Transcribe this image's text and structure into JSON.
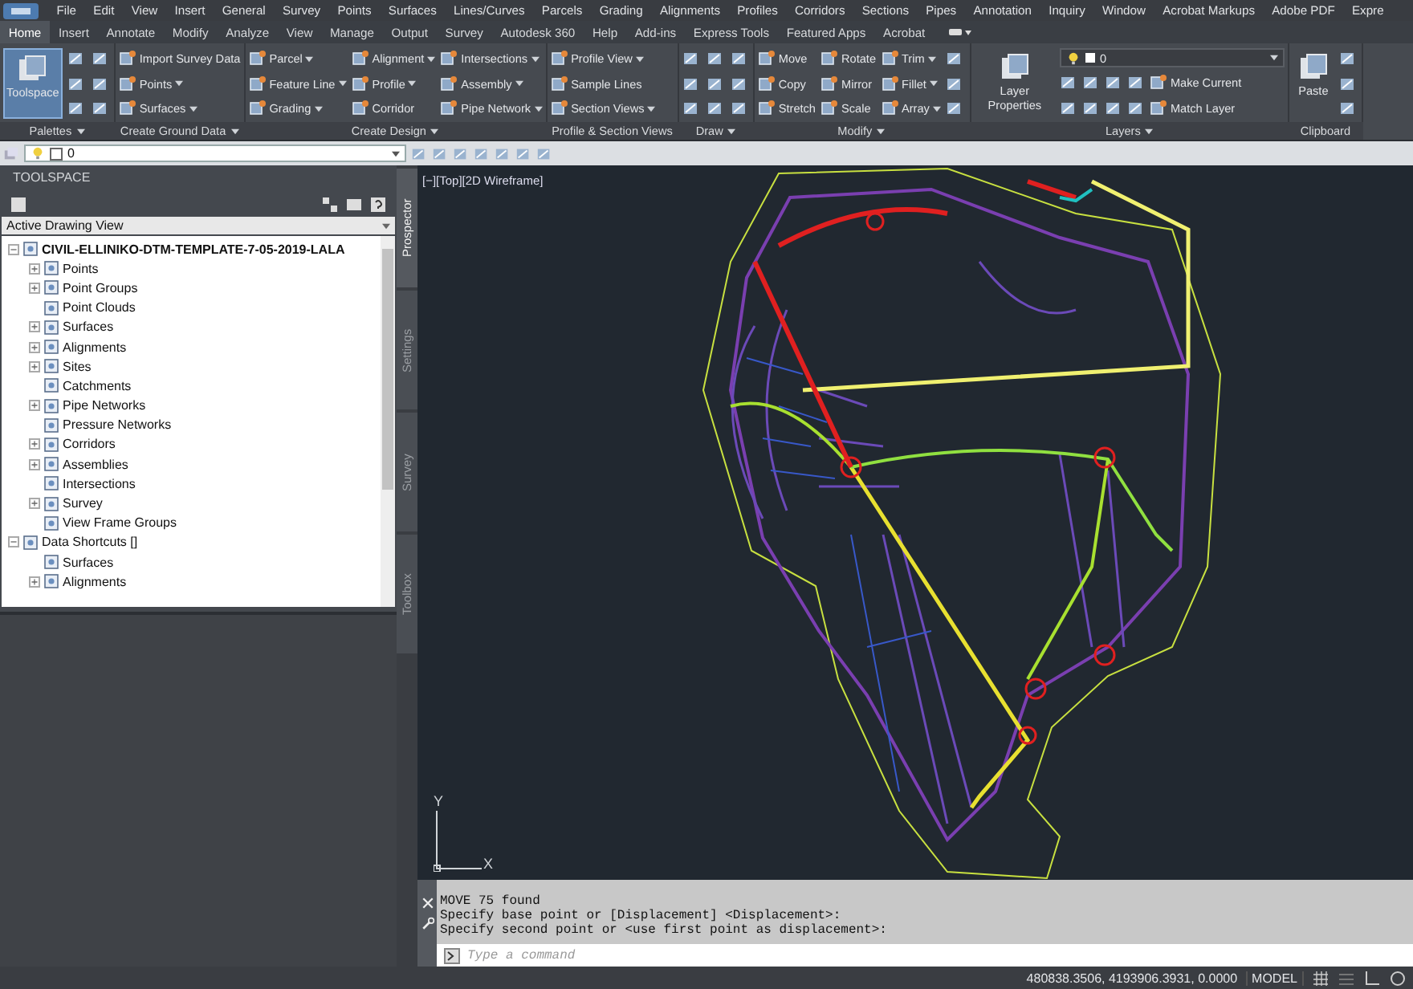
{
  "menu_bar": {
    "items": [
      "File",
      "Edit",
      "View",
      "Insert",
      "General",
      "Survey",
      "Points",
      "Surfaces",
      "Lines/Curves",
      "Parcels",
      "Grading",
      "Alignments",
      "Profiles",
      "Corridors",
      "Sections",
      "Pipes",
      "Annotation",
      "Inquiry",
      "Window",
      "Acrobat Markups",
      "Adobe PDF",
      "Expre"
    ]
  },
  "ribbon_tabs": [
    {
      "label": "Home",
      "selected": true
    },
    {
      "label": "Insert",
      "selected": false
    },
    {
      "label": "Annotate",
      "selected": false
    },
    {
      "label": "Modify",
      "selected": false
    },
    {
      "label": "Analyze",
      "selected": false
    },
    {
      "label": "View",
      "selected": false
    },
    {
      "label": "Manage",
      "selected": false
    },
    {
      "label": "Output",
      "selected": false
    },
    {
      "label": "Survey",
      "selected": false
    },
    {
      "label": "Autodesk 360",
      "selected": false
    },
    {
      "label": "Help",
      "selected": false
    },
    {
      "label": "Add-ins",
      "selected": false
    },
    {
      "label": "Express Tools",
      "selected": false
    },
    {
      "label": "Featured Apps",
      "selected": false
    },
    {
      "label": "Acrobat",
      "selected": false
    }
  ],
  "ribbon_panels": [
    {
      "title": "Palettes",
      "dropdown": true,
      "columns": [
        [
          {
            "kind": "large",
            "label": "Toolspace",
            "selected": true
          }
        ],
        [
          {
            "kind": "icon"
          },
          {
            "kind": "icon"
          },
          {
            "kind": "icon"
          }
        ],
        [
          {
            "kind": "icon"
          },
          {
            "kind": "icon"
          },
          {
            "kind": "icon"
          }
        ]
      ]
    },
    {
      "title": "Create Ground Data",
      "dropdown": true,
      "columns": [
        [
          {
            "kind": "small",
            "label": "Import Survey Data",
            "dropdown": false
          },
          {
            "kind": "small",
            "label": "Points",
            "dropdown": true
          },
          {
            "kind": "small",
            "label": "Surfaces",
            "dropdown": true
          }
        ]
      ]
    },
    {
      "title": "Create Design",
      "dropdown": true,
      "columns": [
        [
          {
            "kind": "small",
            "label": "Parcel",
            "dropdown": true
          },
          {
            "kind": "small",
            "label": "Feature Line",
            "dropdown": true
          },
          {
            "kind": "small",
            "label": "Grading",
            "dropdown": true
          }
        ],
        [
          {
            "kind": "small",
            "label": "Alignment",
            "dropdown": true
          },
          {
            "kind": "small",
            "label": "Profile",
            "dropdown": true
          },
          {
            "kind": "small",
            "label": "Corridor",
            "dropdown": false
          }
        ],
        [
          {
            "kind": "small",
            "label": "Intersections",
            "dropdown": true
          },
          {
            "kind": "small",
            "label": "Assembly",
            "dropdown": true
          },
          {
            "kind": "small",
            "label": "Pipe Network",
            "dropdown": true
          }
        ]
      ]
    },
    {
      "title": "Profile & Section Views",
      "dropdown": false,
      "columns": [
        [
          {
            "kind": "small",
            "label": "Profile View",
            "dropdown": true
          },
          {
            "kind": "small",
            "label": "Sample Lines",
            "dropdown": false
          },
          {
            "kind": "small",
            "label": "Section Views",
            "dropdown": true
          }
        ]
      ]
    },
    {
      "title": "Draw",
      "dropdown": true,
      "columns": [
        [
          {
            "kind": "icon"
          },
          {
            "kind": "icon"
          },
          {
            "kind": "icon"
          }
        ],
        [
          {
            "kind": "icon"
          },
          {
            "kind": "icon"
          },
          {
            "kind": "icon"
          }
        ],
        [
          {
            "kind": "icon"
          },
          {
            "kind": "icon"
          },
          {
            "kind": "icon"
          }
        ]
      ]
    },
    {
      "title": "Modify",
      "dropdown": true,
      "columns": [
        [
          {
            "kind": "small",
            "label": "Move",
            "dropdown": false
          },
          {
            "kind": "small",
            "label": "Copy",
            "dropdown": false
          },
          {
            "kind": "small",
            "label": "Stretch",
            "dropdown": false
          }
        ],
        [
          {
            "kind": "small",
            "label": "Rotate",
            "dropdown": false
          },
          {
            "kind": "small",
            "label": "Mirror",
            "dropdown": false
          },
          {
            "kind": "small",
            "label": "Scale",
            "dropdown": false
          }
        ],
        [
          {
            "kind": "small",
            "label": "Trim",
            "dropdown": true
          },
          {
            "kind": "small",
            "label": "Fillet",
            "dropdown": true
          },
          {
            "kind": "small",
            "label": "Array",
            "dropdown": true
          }
        ],
        [
          {
            "kind": "icon"
          },
          {
            "kind": "icon"
          },
          {
            "kind": "icon"
          }
        ]
      ]
    },
    {
      "title": "Layers",
      "dropdown": true,
      "columns": [
        [
          {
            "kind": "large",
            "label": "Layer Properties",
            "selected": false
          }
        ],
        [
          {
            "kind": "combo",
            "value": "0"
          },
          {
            "kind": "row",
            "items": [
              {
                "kind": "icon"
              },
              {
                "kind": "icon"
              },
              {
                "kind": "icon"
              },
              {
                "kind": "icon"
              },
              {
                "kind": "small",
                "label": "Make Current",
                "dropdown": false
              }
            ]
          },
          {
            "kind": "row",
            "items": [
              {
                "kind": "icon"
              },
              {
                "kind": "icon"
              },
              {
                "kind": "icon"
              },
              {
                "kind": "icon"
              },
              {
                "kind": "small",
                "label": "Match Layer",
                "dropdown": false
              }
            ]
          }
        ]
      ]
    },
    {
      "title": "Clipboard",
      "dropdown": false,
      "columns": [
        [
          {
            "kind": "large",
            "label": "Paste",
            "selected": false
          }
        ],
        [
          {
            "kind": "icon"
          },
          {
            "kind": "icon"
          },
          {
            "kind": "icon"
          }
        ]
      ]
    }
  ],
  "layer_toolbar": {
    "layer": "0"
  },
  "toolspace": {
    "title": "TOOLSPACE",
    "view": "Active Drawing View",
    "tree": [
      {
        "label": "CIVIL-ELLINIKO-DTM-TEMPLATE-7-05-2019-LALA",
        "bold": true,
        "expanded": true,
        "children": [
          {
            "label": "Points",
            "expandable": true
          },
          {
            "label": "Point Groups",
            "expandable": true
          },
          {
            "label": "Point Clouds",
            "expandable": false
          },
          {
            "label": "Surfaces",
            "expandable": true
          },
          {
            "label": "Alignments",
            "expandable": true
          },
          {
            "label": "Sites",
            "expandable": true
          },
          {
            "label": "Catchments",
            "expandable": false
          },
          {
            "label": "Pipe Networks",
            "expandable": true
          },
          {
            "label": "Pressure Networks",
            "expandable": false
          },
          {
            "label": "Corridors",
            "expandable": true
          },
          {
            "label": "Assemblies",
            "expandable": true
          },
          {
            "label": "Intersections",
            "expandable": false
          },
          {
            "label": "Survey",
            "expandable": true
          },
          {
            "label": "View Frame Groups",
            "expandable": false
          }
        ]
      },
      {
        "label": "Data Shortcuts []",
        "bold": false,
        "expanded": true,
        "children": [
          {
            "label": "Surfaces",
            "expandable": false
          },
          {
            "label": "Alignments",
            "expandable": true
          }
        ]
      }
    ],
    "side_tabs": [
      {
        "label": "Prospector",
        "selected": true
      },
      {
        "label": "Settings",
        "selected": false
      },
      {
        "label": "Survey",
        "selected": false
      },
      {
        "label": "Toolbox",
        "selected": false
      }
    ]
  },
  "viewport": {
    "label": "[−][Top][2D Wireframe]",
    "ucs_y": "Y",
    "ucs_x": "X"
  },
  "command_line": {
    "history": [
      "MOVE 75 found",
      "Specify base point or [Displacement] <Displacement>:",
      "Specify second point or <use first point as displacement>:"
    ],
    "placeholder": "Type a command"
  },
  "status_bar": {
    "coordinates": "480838.3506, 4193906.3931, 0.0000",
    "space": "MODEL"
  }
}
